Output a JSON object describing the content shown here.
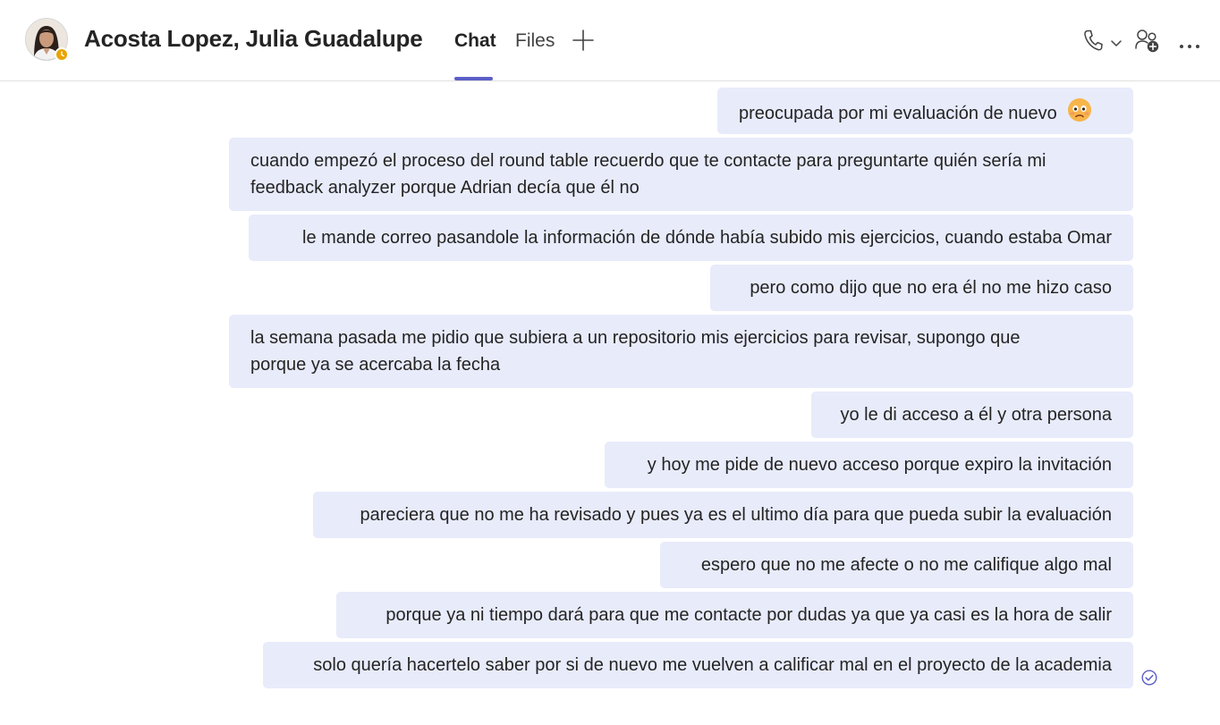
{
  "header": {
    "contact_name": "Acosta Lopez, Julia Guadalupe",
    "presence": "away",
    "tabs": [
      {
        "label": "Chat",
        "active": true
      },
      {
        "label": "Files",
        "active": false
      }
    ],
    "add_tab_icon": "plus-icon",
    "actions": [
      "phone-icon",
      "chevron-down-icon",
      "add-people-icon",
      "more-options-icon"
    ]
  },
  "messages": [
    {
      "text": "preocupada por mi evaluación de nuevo",
      "emoji": "worried-face-emoji"
    },
    {
      "text": "cuando empezó el proceso del round table recuerdo que te contacte para preguntarte quién sería mi\nfeedback analyzer porque Adrian decía que él no"
    },
    {
      "text": "le mande correo pasandole la información de dónde había subido mis ejercicios, cuando estaba Omar"
    },
    {
      "text": "pero como dijo que no era él no me hizo caso"
    },
    {
      "text": "la semana pasada me pidio que subiera a un repositorio mis ejercicios para revisar, supongo que\nporque ya se acercaba la fecha"
    },
    {
      "text": "yo le di acceso a él y otra persona"
    },
    {
      "text": "y hoy me pide de nuevo acceso porque expiro la invitación"
    },
    {
      "text": "pareciera que no me ha revisado y pues ya es el ultimo día para que pueda subir la evaluación"
    },
    {
      "text": "espero que no me afecte o no me califique algo mal"
    },
    {
      "text": "porque ya ni tiempo dará para que me contacte por dudas ya que ya casi es la hora de salir"
    },
    {
      "text": "solo quería hacertelo saber por si de nuevo me vuelven a calificar mal en el proyecto de la academia"
    }
  ],
  "status_icon": "read-receipt-icon",
  "colors": {
    "accent": "#5b5fc7",
    "bubble": "#e8ebfa",
    "presence_away": "#eaa300",
    "text": "#242424"
  }
}
